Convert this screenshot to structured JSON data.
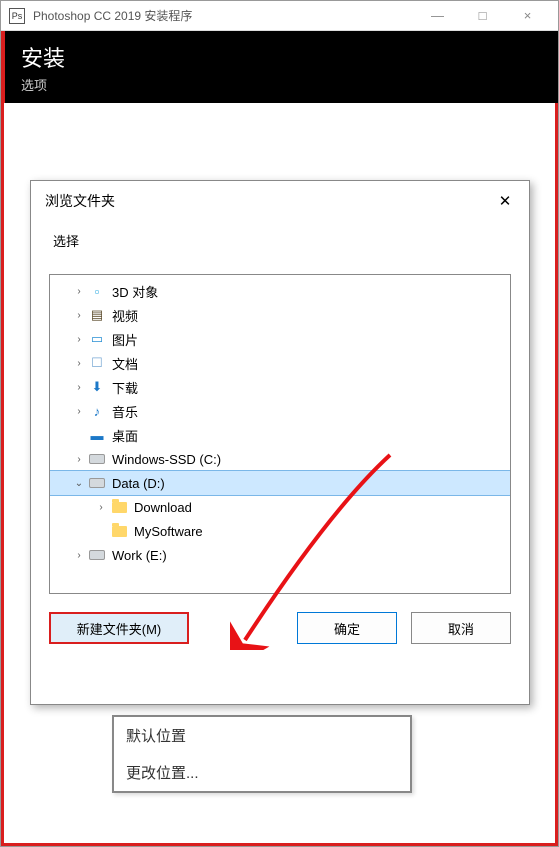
{
  "titlebar": {
    "icon_label": "Ps",
    "title": "Photoshop CC 2019 安装程序",
    "minimize": "—",
    "maximize": "□",
    "close": "×"
  },
  "header": {
    "title": "安装",
    "subtitle": "选项"
  },
  "dropdown": {
    "items": [
      "默认位置",
      "更改位置..."
    ]
  },
  "dialog": {
    "title": "浏览文件夹",
    "close": "✕",
    "label": "选择",
    "tree": [
      {
        "expander": "›",
        "icon": "cube-icon",
        "glyph": "▫",
        "color": "#2aa9e0",
        "label": "3D 对象",
        "indent": 1
      },
      {
        "expander": "›",
        "icon": "video-icon",
        "glyph": "▤",
        "color": "#5a4a2a",
        "label": "视频",
        "indent": 1
      },
      {
        "expander": "›",
        "icon": "pictures-icon",
        "glyph": "▭",
        "color": "#2a8fd4",
        "label": "图片",
        "indent": 1
      },
      {
        "expander": "›",
        "icon": "documents-icon",
        "glyph": "☐",
        "color": "#7aa9d4",
        "label": "文档",
        "indent": 1
      },
      {
        "expander": "›",
        "icon": "downloads-icon",
        "glyph": "⬇",
        "color": "#1c78c8",
        "label": "下载",
        "indent": 1
      },
      {
        "expander": "›",
        "icon": "music-icon",
        "glyph": "♪",
        "color": "#1c78c8",
        "label": "音乐",
        "indent": 1
      },
      {
        "expander": "",
        "icon": "desktop-icon",
        "glyph": "▬",
        "color": "#1c78c8",
        "label": "桌面",
        "indent": 1
      },
      {
        "expander": "›",
        "icon": "drive-icon",
        "glyph": "drive",
        "color": "",
        "label": "Windows-SSD (C:)",
        "indent": 1
      },
      {
        "expander": "⌄",
        "icon": "drive-icon",
        "glyph": "drive",
        "color": "",
        "label": "Data (D:)",
        "indent": 1,
        "selected": true
      },
      {
        "expander": "›",
        "icon": "folder-icon",
        "glyph": "folder",
        "color": "",
        "label": "Download",
        "indent": 2
      },
      {
        "expander": "",
        "icon": "folder-icon",
        "glyph": "folder",
        "color": "",
        "label": "MySoftware",
        "indent": 2
      },
      {
        "expander": "›",
        "icon": "drive-icon",
        "glyph": "drive",
        "color": "",
        "label": "Work (E:)",
        "indent": 1
      }
    ],
    "buttons": {
      "new_folder": "新建文件夹(M)",
      "ok": "确定",
      "cancel": "取消"
    }
  }
}
